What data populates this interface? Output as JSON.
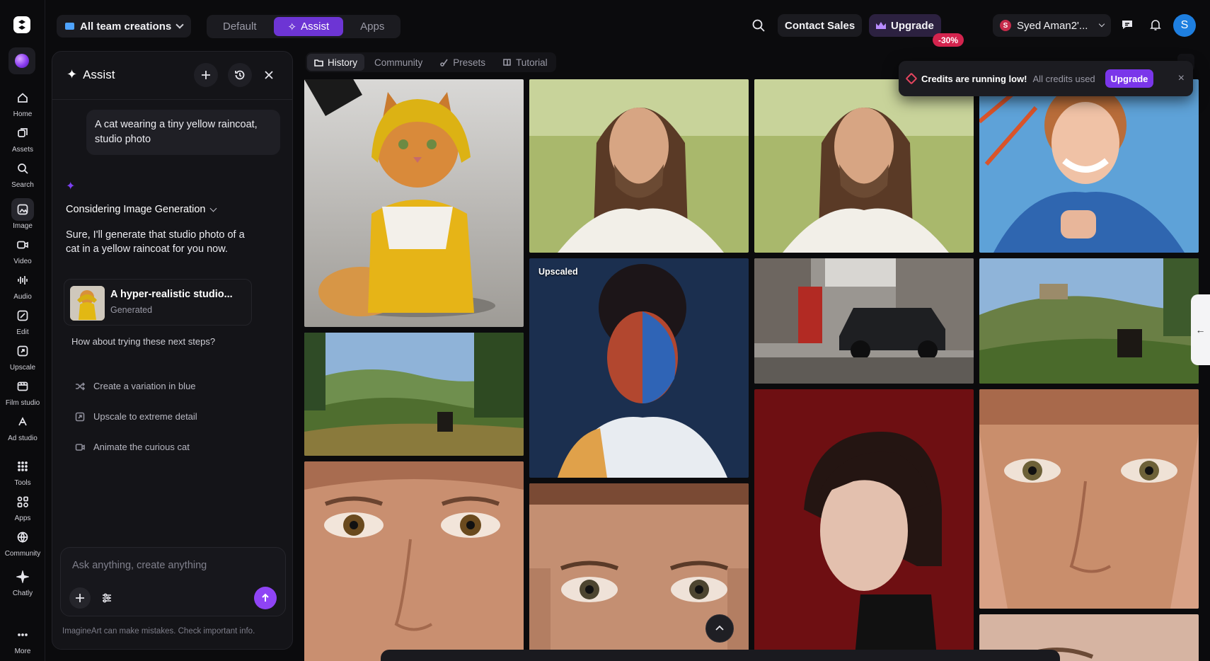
{
  "header": {
    "team_selector": "All team creations",
    "modes": [
      "Default",
      "Assist",
      "Apps"
    ],
    "active_mode": "Assist",
    "contact_sales": "Contact Sales",
    "upgrade": "Upgrade",
    "discount": "-30%",
    "user_badge": "S",
    "user_name": "Syed Aman2'...",
    "avatar_initial": "S"
  },
  "rail": {
    "items": [
      {
        "label": "Home",
        "icon": "home-icon"
      },
      {
        "label": "Assets",
        "icon": "assets-icon"
      },
      {
        "label": "Search",
        "icon": "search-icon"
      },
      {
        "label": "Image",
        "icon": "image-icon"
      },
      {
        "label": "Video",
        "icon": "video-icon"
      },
      {
        "label": "Audio",
        "icon": "audio-icon"
      },
      {
        "label": "Edit",
        "icon": "edit-icon"
      },
      {
        "label": "Upscale",
        "icon": "upscale-icon"
      },
      {
        "label": "Film studio",
        "icon": "film-icon"
      },
      {
        "label": "Ad studio",
        "icon": "ad-studio-icon"
      },
      {
        "label": "Tools",
        "icon": "grid-icon"
      },
      {
        "label": "Apps",
        "icon": "apps-icon"
      },
      {
        "label": "Community",
        "icon": "globe-icon"
      },
      {
        "label": "Chatly",
        "icon": "chatly-icon"
      },
      {
        "label": "More",
        "icon": "more-icon"
      }
    ],
    "active": "Image"
  },
  "assist": {
    "title": "Assist",
    "user_message": "A cat wearing a tiny yellow raincoat, studio photo",
    "considering": "Considering Image Generation",
    "reply": "Sure, I'll generate that studio photo of a cat in a yellow raincoat for you now.",
    "generated_card": {
      "title": "A hyper-realistic studio...",
      "status": "Generated"
    },
    "next_steps_heading": "How about trying these next steps?",
    "next_steps": [
      "Create a variation in blue",
      "Upscale to extreme detail",
      "Animate the curious cat"
    ],
    "composer_placeholder": "Ask anything, create anything",
    "disclaimer": "ImagineArt can make mistakes. Check important info."
  },
  "gallery": {
    "tabs": [
      "History",
      "Community",
      "Presets",
      "Tutorial"
    ],
    "active_tab": "History",
    "tiles": [
      {
        "alt": "Orange cat in yellow raincoat"
      },
      {
        "alt": "Man with long hair in meadow"
      },
      {
        "alt": "Man with long hair in meadow"
      },
      {
        "alt": "Smiling girl on playground"
      },
      {
        "alt": "Tuscan hills with rider"
      },
      {
        "alt": "Portrait with blue and red lighting",
        "badge": "Upscaled"
      },
      {
        "alt": "Car and red phone booth"
      },
      {
        "alt": "Hillside village with rider"
      },
      {
        "alt": "Freckled face close-up"
      },
      {
        "alt": "Woman with bob haircut on red background"
      },
      {
        "alt": "Freckled face with hands"
      },
      {
        "alt": "Freckled face close-up"
      },
      {
        "alt": "Partial portrait"
      }
    ]
  },
  "toast": {
    "title": "Credits are running low!",
    "message": "All credits used",
    "button": "Upgrade",
    "close": "×"
  },
  "colors": {
    "accent": "#7a36ea",
    "brand_purple": "#6d35d4",
    "discount": "#d3244e",
    "avatar": "#1e7fe0"
  }
}
